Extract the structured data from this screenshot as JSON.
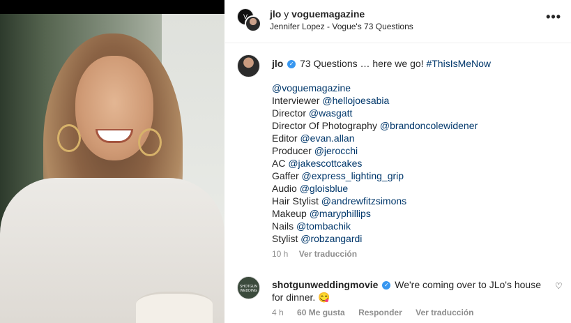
{
  "header": {
    "author1": "jlo",
    "joiner": "y",
    "author2": "voguemagazine",
    "subtitle": "Jennifer Lopez - Vogue's 73 Questions",
    "more_label": "•••"
  },
  "post": {
    "username": "jlo",
    "caption_text": "73 Questions … here we go!",
    "hashtag": "#ThisIsMeNow",
    "credits": [
      {
        "label": "",
        "handle": "@voguemagazine"
      },
      {
        "label": "Interviewer",
        "handle": "@hellojoesabia"
      },
      {
        "label": "Director",
        "handle": "@wasgatt"
      },
      {
        "label": "Director Of Photography",
        "handle": "@brandoncolewidener"
      },
      {
        "label": "Editor",
        "handle": "@evan.allan"
      },
      {
        "label": "Producer",
        "handle": "@jerocchi"
      },
      {
        "label": "AC",
        "handle": "@jakescottcakes"
      },
      {
        "label": "Gaffer",
        "handle": "@express_lighting_grip"
      },
      {
        "label": "Audio",
        "handle": "@gloisblue"
      },
      {
        "label": "Hair Stylist",
        "handle": "@andrewfitzsimons"
      },
      {
        "label": "Makeup",
        "handle": "@maryphillips"
      },
      {
        "label": "Nails",
        "handle": "@tombachik"
      },
      {
        "label": "Stylist",
        "handle": "@robzangardi"
      }
    ],
    "time": "10 h",
    "translate": "Ver traducción"
  },
  "comment": {
    "username": "shotgunweddingmovie",
    "text": "We're coming over to JLo's house for dinner. 😋",
    "avatar_text": "SHOTGUN WEDDING",
    "time": "4 h",
    "likes": "60 Me gusta",
    "reply": "Responder",
    "translate": "Ver traducción"
  },
  "colors": {
    "link": "#00376b",
    "verified": "#3897f0",
    "muted": "#8e8e8e"
  }
}
